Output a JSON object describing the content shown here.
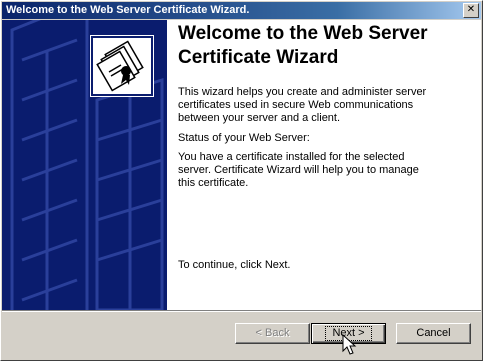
{
  "window": {
    "title": "Welcome to the Web Server Certificate Wizard.",
    "close_label": "✕"
  },
  "main": {
    "heading": "Welcome to the Web Server Certificate Wizard",
    "intro": "This wizard helps you create and administer server certificates used in secure Web communications between your server and a client.",
    "status_label": "Status of your Web Server:",
    "status_text": "You have a certificate installed for the selected server. Certificate Wizard will help you to manage this certificate.",
    "continue_text": "To continue, click Next."
  },
  "buttons": {
    "back": "< Back",
    "next": "Next >",
    "cancel": "Cancel"
  },
  "colors": {
    "banner": "#0a1c6e",
    "titlebar": "#0a246a",
    "dialog": "#d4d0c8"
  },
  "icons": {
    "banner_graphic": "certificate-stack-icon",
    "cursor": "mouse-pointer-icon",
    "close": "close-icon"
  }
}
